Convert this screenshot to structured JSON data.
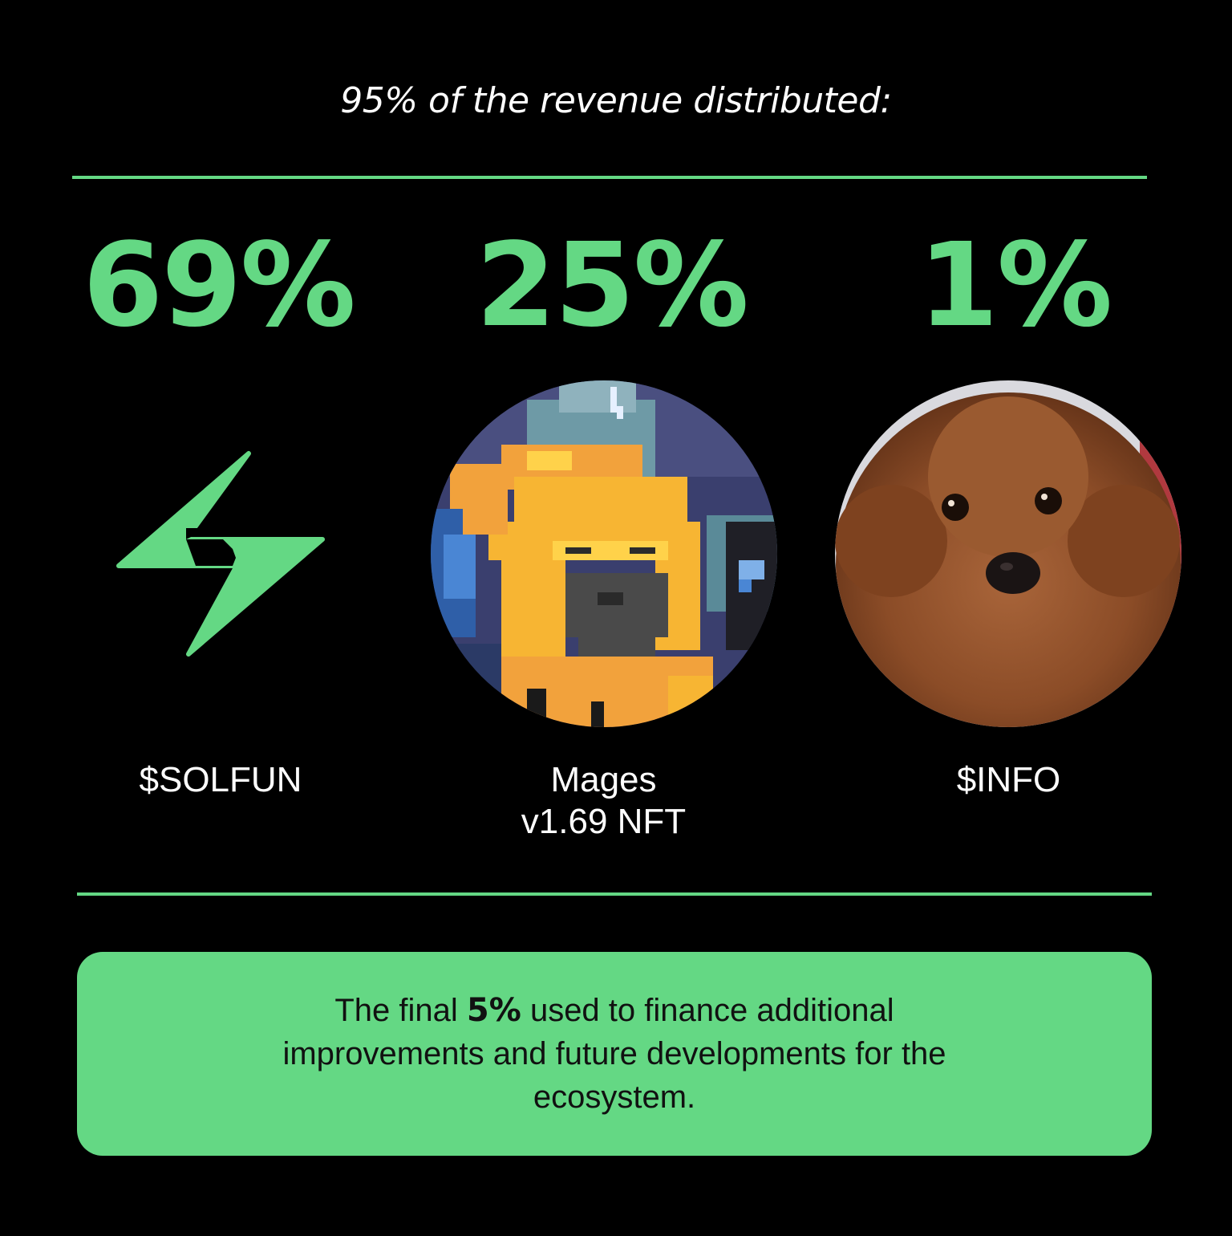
{
  "headline": "95% of the revenue distributed:",
  "accent_color": "#64d884",
  "allocations": [
    {
      "percent": "69%",
      "name": "$SOLFUN",
      "image": "lightning-bolt-logo-icon"
    },
    {
      "percent": "25%",
      "name_line1": "Mages",
      "name_line2": "v1.69 NFT",
      "image": "pixel-mage-avatar"
    },
    {
      "percent": "1%",
      "name": "$INFO",
      "image": "poodle-dog-avatar"
    }
  ],
  "footer": {
    "text_before": "The final ",
    "highlight": "5%",
    "text_after": " used to finance additional improvements and future developments for the ecosystem."
  }
}
